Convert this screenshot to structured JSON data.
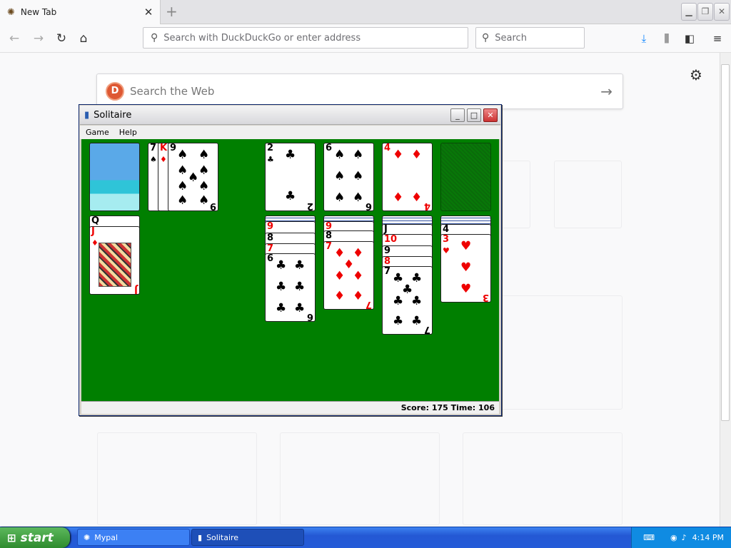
{
  "browser": {
    "tab_title": "New Tab",
    "tab_close": "✕",
    "new_tab": "+",
    "url_placeholder": "Search with DuckDuckGo or enter address",
    "search_placeholder": "Search",
    "web_search_placeholder": "Search the Web",
    "nav_icons": [
      "back-icon",
      "forward-icon",
      "reload-icon",
      "home-icon"
    ],
    "toolbar_icons": [
      "download-icon",
      "library-icon",
      "sidebar-icon",
      "menu-icon"
    ]
  },
  "solitaire": {
    "title": "Solitaire",
    "menu": [
      "Game",
      "Help"
    ],
    "status": "Score: 175 Time: 106",
    "stock": "stock-beach-back",
    "waste": [
      "7",
      "K",
      "9"
    ],
    "foundations": [
      {
        "rank": "2",
        "suit": "♣",
        "color": "black"
      },
      {
        "rank": "6",
        "suit": "♠",
        "color": "black"
      },
      {
        "rank": "4",
        "suit": "♦",
        "color": "red"
      },
      {
        "rank": "",
        "suit": "",
        "color": "empty"
      }
    ],
    "tableau": [
      {
        "cards": [
          "Q",
          "J"
        ]
      },
      {
        "cards": [
          "9",
          "8",
          "7",
          "6"
        ]
      },
      {
        "cards": [
          "9",
          "8",
          "7"
        ]
      },
      {
        "cards": [
          "J",
          "10",
          "9",
          "8",
          "7"
        ]
      },
      {
        "cards": [
          "4",
          "3"
        ]
      }
    ],
    "pips": {
      "club": "♣",
      "spade": "♠",
      "heart": "♥",
      "diamond": "♦"
    }
  },
  "taskbar": {
    "start": "start",
    "tasks": [
      "Mypal",
      "Solitaire"
    ],
    "clock": "4:14 PM"
  },
  "colors": {
    "felt": "#007f00",
    "taskbar": "#245bd8",
    "start": "#2e8b2e"
  }
}
